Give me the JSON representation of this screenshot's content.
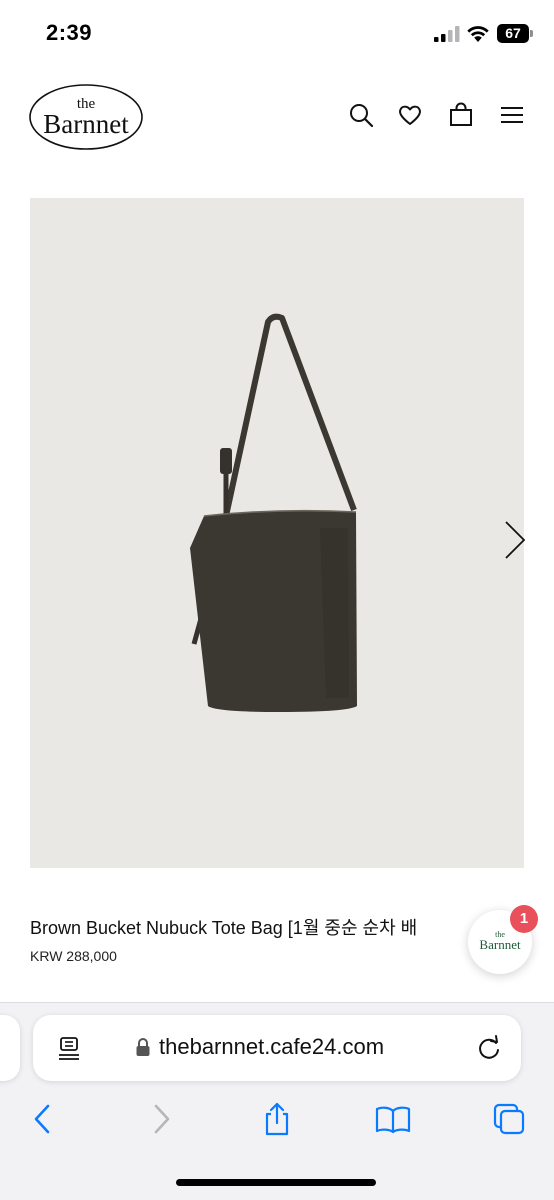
{
  "status_bar": {
    "time": "2:39",
    "battery": "67",
    "icons": [
      "cellular-signal-icon",
      "wifi-icon",
      "battery-icon"
    ]
  },
  "header": {
    "logo_top": "the",
    "logo_main": "Barnnet",
    "icons": [
      "search-icon",
      "heart-icon",
      "shopping-bag-icon",
      "menu-icon"
    ]
  },
  "product": {
    "name": "Brown Bucket Nubuck Tote Bag [1월 중순 순차 배",
    "price": "KRW 288,000",
    "image_background": "#e9e8e4",
    "bag_color": "#3b3731"
  },
  "chat": {
    "badge_count": "1",
    "logo_top": "the",
    "logo_main": "Barnnet",
    "logo_color": "#1f5a3a",
    "badge_color": "#e8505b"
  },
  "browser": {
    "url": "thebarnnet.cafe24.com",
    "accent": "#0a7aff",
    "toolbar": [
      "back-icon",
      "forward-icon",
      "share-icon",
      "bookmarks-icon",
      "tabs-icon"
    ]
  }
}
